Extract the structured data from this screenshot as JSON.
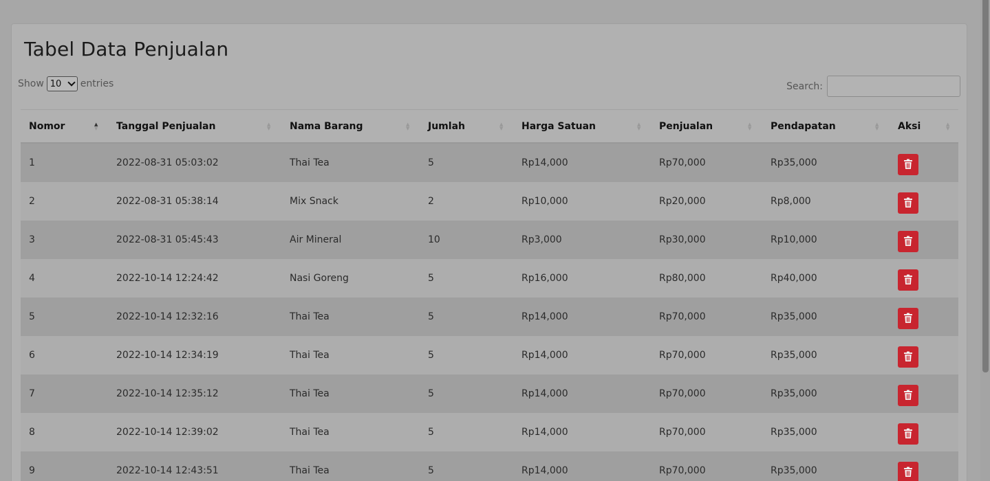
{
  "page": {
    "title": "Tabel Data Penjualan"
  },
  "controls": {
    "show_label": "Show",
    "entries_value": "10",
    "entries_label": "entries",
    "search_label": "Search:",
    "search_value": ""
  },
  "table": {
    "headers": [
      "Nomor",
      "Tanggal Penjualan",
      "Nama Barang",
      "Jumlah",
      "Harga Satuan",
      "Penjualan",
      "Pendapatan",
      "Aksi"
    ],
    "rows": [
      [
        "1",
        "2022-08-31 05:03:02",
        "Thai Tea",
        "5",
        "Rp14,000",
        "Rp70,000",
        "Rp35,000"
      ],
      [
        "2",
        "2022-08-31 05:38:14",
        "Mix Snack",
        "2",
        "Rp10,000",
        "Rp20,000",
        "Rp8,000"
      ],
      [
        "3",
        "2022-08-31 05:45:43",
        "Air Mineral",
        "10",
        "Rp3,000",
        "Rp30,000",
        "Rp10,000"
      ],
      [
        "4",
        "2022-10-14 12:24:42",
        "Nasi Goreng",
        "5",
        "Rp16,000",
        "Rp80,000",
        "Rp40,000"
      ],
      [
        "5",
        "2022-10-14 12:32:16",
        "Thai Tea",
        "5",
        "Rp14,000",
        "Rp70,000",
        "Rp35,000"
      ],
      [
        "6",
        "2022-10-14 12:34:19",
        "Thai Tea",
        "5",
        "Rp14,000",
        "Rp70,000",
        "Rp35,000"
      ],
      [
        "7",
        "2022-10-14 12:35:12",
        "Thai Tea",
        "5",
        "Rp14,000",
        "Rp70,000",
        "Rp35,000"
      ],
      [
        "8",
        "2022-10-14 12:39:02",
        "Thai Tea",
        "5",
        "Rp14,000",
        "Rp70,000",
        "Rp35,000"
      ],
      [
        "9",
        "2022-10-14 12:43:51",
        "Thai Tea",
        "5",
        "Rp14,000",
        "Rp70,000",
        "Rp35,000"
      ]
    ]
  },
  "colors": {
    "overlay_bg": "#a7a7a7",
    "delete_button": "#c8252f"
  },
  "icons": {
    "delete": "trash-icon",
    "sort": "sort-icon"
  }
}
